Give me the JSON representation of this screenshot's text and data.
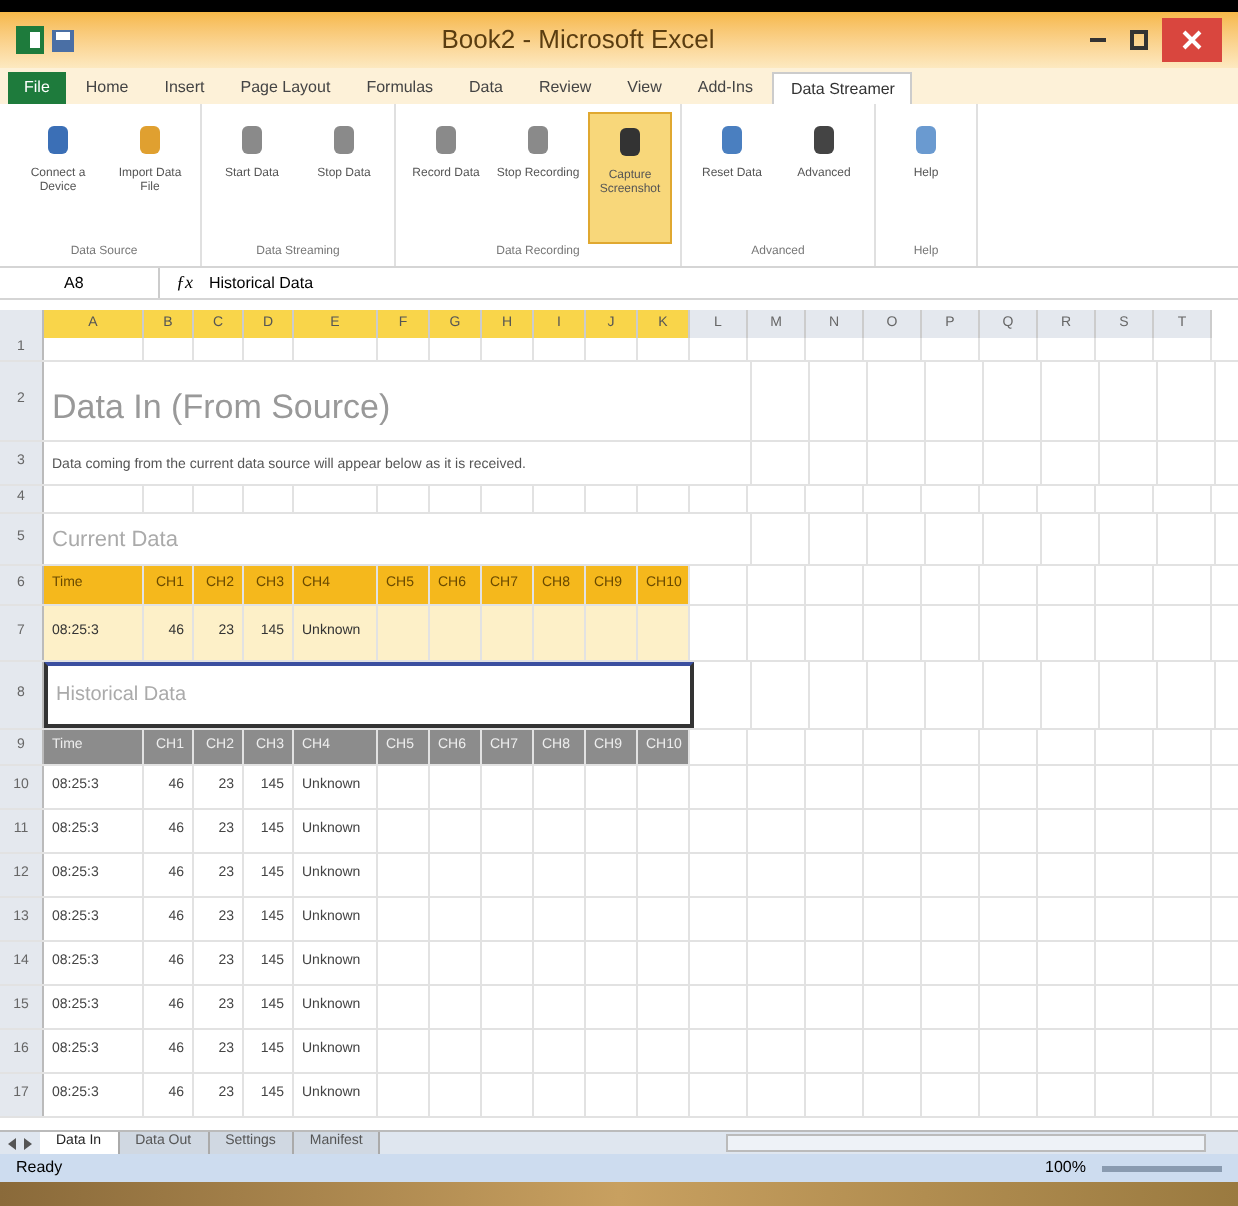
{
  "window": {
    "title": "Book2 - Microsoft Excel"
  },
  "ribbon_tabs": [
    {
      "label": "File",
      "selected": false
    },
    {
      "label": "Home",
      "selected": false
    },
    {
      "label": "Insert",
      "selected": false
    },
    {
      "label": "Page Layout",
      "selected": false
    },
    {
      "label": "Formulas",
      "selected": false
    },
    {
      "label": "Data",
      "selected": false
    },
    {
      "label": "Review",
      "selected": false
    },
    {
      "label": "View",
      "selected": false
    },
    {
      "label": "Add-Ins",
      "selected": false
    },
    {
      "label": "Data Streamer",
      "selected": true
    }
  ],
  "ribbon_groups": [
    {
      "label": "Data Source",
      "buttons": [
        {
          "label": "Connect a Device",
          "selected": false
        },
        {
          "label": "Import Data File",
          "selected": false
        }
      ]
    },
    {
      "label": "Data Streaming",
      "buttons": [
        {
          "label": "Start Data",
          "selected": false
        },
        {
          "label": "Stop Data",
          "selected": false
        }
      ]
    },
    {
      "label": "Data Recording",
      "buttons": [
        {
          "label": "Record Data",
          "selected": false
        },
        {
          "label": "Stop Recording",
          "selected": false
        },
        {
          "label": "Capture Screenshot",
          "selected": true
        }
      ]
    },
    {
      "label": "Advanced",
      "buttons": [
        {
          "label": "Reset Data",
          "selected": false
        },
        {
          "label": "Advanced",
          "selected": false
        }
      ]
    },
    {
      "label": "Help",
      "buttons": [
        {
          "label": "Help",
          "selected": false
        }
      ]
    }
  ],
  "name_box": "A8",
  "function_label": "ƒx",
  "formula": "Historical Data",
  "row_numbers": [
    "1",
    "2",
    "3",
    "4",
    "5",
    "6",
    "7",
    "8",
    "9",
    "10",
    "11",
    "12",
    "13",
    "14",
    "15",
    "16",
    "17"
  ],
  "columns": [
    {
      "label": "A",
      "highlighted": true
    },
    {
      "label": "B",
      "highlighted": true
    },
    {
      "label": "C",
      "highlighted": true
    },
    {
      "label": "D",
      "highlighted": true
    },
    {
      "label": "E",
      "highlighted": true
    },
    {
      "label": "F",
      "highlighted": true
    },
    {
      "label": "G",
      "highlighted": true
    },
    {
      "label": "H",
      "highlighted": true
    },
    {
      "label": "I",
      "highlighted": true
    },
    {
      "label": "J",
      "highlighted": true
    },
    {
      "label": "K",
      "highlighted": true
    },
    {
      "label": "L",
      "highlighted": false
    },
    {
      "label": "M",
      "highlighted": false
    },
    {
      "label": "N",
      "highlighted": false
    },
    {
      "label": "O",
      "highlighted": false
    },
    {
      "label": "P",
      "highlighted": false
    },
    {
      "label": "Q",
      "highlighted": false
    },
    {
      "label": "R",
      "highlighted": false
    },
    {
      "label": "S",
      "highlighted": false
    },
    {
      "label": "T",
      "highlighted": false
    }
  ],
  "sheet": {
    "title": "Data In (From Source)",
    "description": "Data coming from the current data source will appear below as it is received.",
    "current_label": "Current Data",
    "current_headers": [
      "Time",
      "CH1",
      "CH2",
      "CH3",
      "CH4",
      "CH5",
      "CH6",
      "CH7",
      "CH8",
      "CH9",
      "CH10"
    ],
    "current_row": [
      "08:25:3",
      "46",
      "23",
      "145",
      "Unknown"
    ],
    "historical_label": "Historical Data",
    "historical_headers": [
      "Time",
      "CH1",
      "CH2",
      "CH3",
      "CH4",
      "CH5",
      "CH6",
      "CH7",
      "CH8",
      "CH9",
      "CH10"
    ],
    "historical_rows": [
      [
        "08:25:3",
        "46",
        "23",
        "145",
        "Unknown"
      ],
      [
        "08:25:3",
        "46",
        "23",
        "145",
        "Unknown"
      ],
      [
        "08:25:3",
        "46",
        "23",
        "145",
        "Unknown"
      ],
      [
        "08:25:3",
        "46",
        "23",
        "145",
        "Unknown"
      ],
      [
        "08:25:3",
        "46",
        "23",
        "145",
        "Unknown"
      ],
      [
        "08:25:3",
        "46",
        "23",
        "145",
        "Unknown"
      ],
      [
        "08:25:3",
        "46",
        "23",
        "145",
        "Unknown"
      ],
      [
        "08:25:3",
        "46",
        "23",
        "145",
        "Unknown"
      ]
    ]
  },
  "sheet_tabs": [
    {
      "label": "Data In",
      "selected": true
    },
    {
      "label": "Data Out",
      "selected": false
    },
    {
      "label": "Settings",
      "selected": false
    },
    {
      "label": "Manifest",
      "selected": false
    }
  ],
  "status": "Ready",
  "zoom": "100%"
}
